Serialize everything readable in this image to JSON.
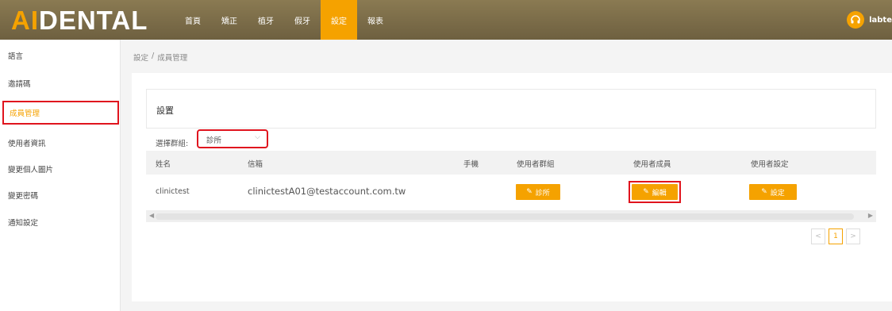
{
  "app": {
    "logo_part1": "AI",
    "logo_part2": "DENTAL"
  },
  "nav": [
    "首頁",
    "矯正",
    "植牙",
    "假牙",
    "設定",
    "報表"
  ],
  "user": {
    "name": "labte",
    "avatar_icon": "headset-icon"
  },
  "sidebar": {
    "items": [
      {
        "label": "語言"
      },
      {
        "label": "邀請碼"
      },
      {
        "label": "成員管理"
      },
      {
        "label": "使用者資訊"
      },
      {
        "label": "變更個人圖片"
      },
      {
        "label": "變更密碼"
      },
      {
        "label": "通知設定"
      }
    ]
  },
  "breadcrumb": {
    "parent": "設定",
    "sep": "/",
    "current": "成員管理"
  },
  "card": {
    "title": "設置"
  },
  "filter": {
    "label": "選擇群組:",
    "value": "診所"
  },
  "table": {
    "headers": [
      "姓名",
      "信箱",
      "手機",
      "使用者群組",
      "使用者成員",
      "使用者設定"
    ],
    "rows": [
      {
        "name": "clinictest",
        "email": "clinictestA01@testaccount.com.tw",
        "phone": "",
        "group_btn": "診所",
        "member_btn": "編輯",
        "settings_btn": "設定"
      }
    ]
  },
  "pagination": {
    "prev": "<",
    "current": "1",
    "next": ">"
  },
  "colors": {
    "accent": "#f5a200",
    "highlight": "#e0141e",
    "topbar": "#7c6d49"
  }
}
